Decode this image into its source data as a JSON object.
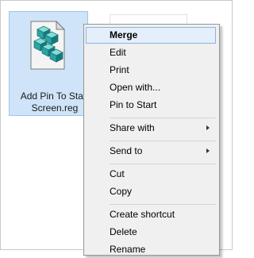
{
  "file": {
    "label": "Add Pin To Start\nScreen.reg",
    "icon": "registry-file-icon"
  },
  "menu": {
    "items": [
      {
        "label": "Merge",
        "highlighted": true
      },
      {
        "label": "Edit"
      },
      {
        "label": "Print"
      },
      {
        "label": "Open with..."
      },
      {
        "label": "Pin to Start"
      },
      {
        "label": "Share with",
        "submenu": true
      },
      {
        "label": "Send to",
        "submenu": true
      },
      {
        "label": "Cut"
      },
      {
        "label": "Copy"
      },
      {
        "label": "Create shortcut"
      },
      {
        "label": "Delete"
      },
      {
        "label": "Rename"
      }
    ]
  },
  "colors": {
    "selection_fill": "#cfe4f8",
    "menu_highlight": "#e4effb",
    "menu_highlight_border": "#8bb2e2",
    "menu_background": "#f0f0f0"
  }
}
